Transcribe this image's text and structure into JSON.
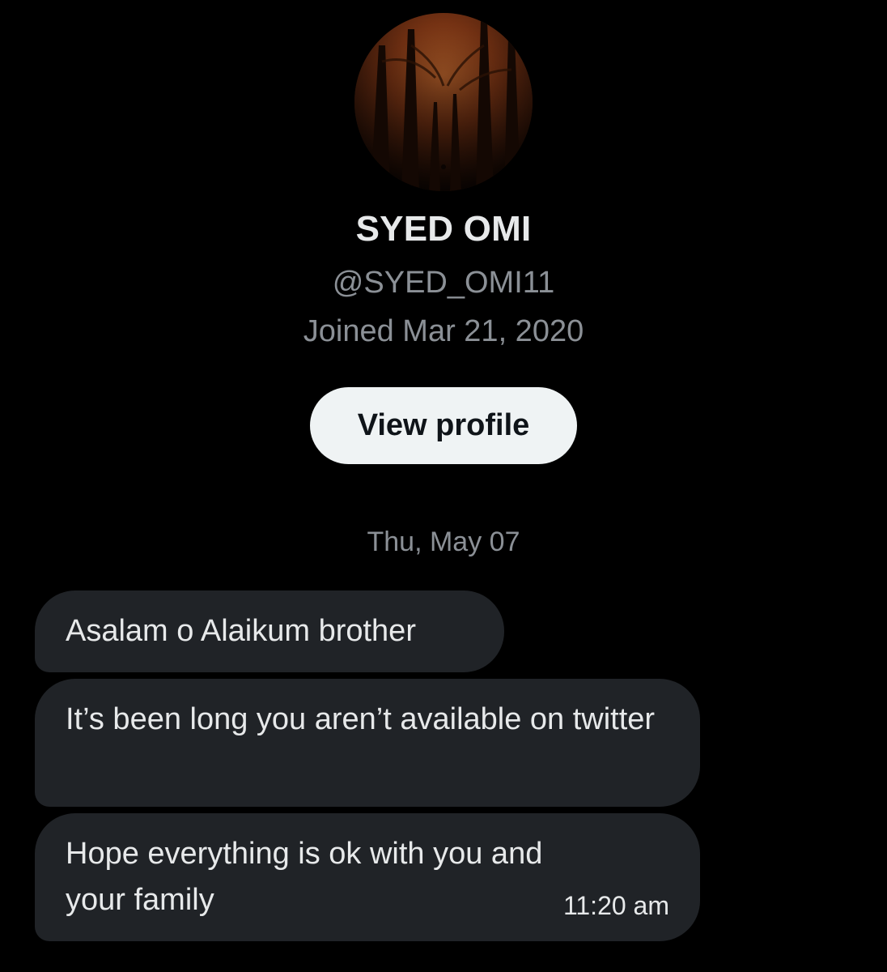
{
  "profile": {
    "name": "SYED OMI",
    "handle": "@SYED_OMI11",
    "joined": "Joined Mar 21, 2020",
    "view_profile_label": "View profile"
  },
  "conversation": {
    "date_separator": "Thu, May 07",
    "messages": [
      {
        "text": "Asalam o Alaikum brother"
      },
      {
        "text": "It’s been long you aren’t available on twitter"
      },
      {
        "text": "Hope everything is ok with you and your family",
        "time": "11:20 am"
      }
    ]
  },
  "colors": {
    "background": "#000000",
    "bubble": "#202327",
    "button": "#eff3f4",
    "muted_text": "#8b9096"
  }
}
